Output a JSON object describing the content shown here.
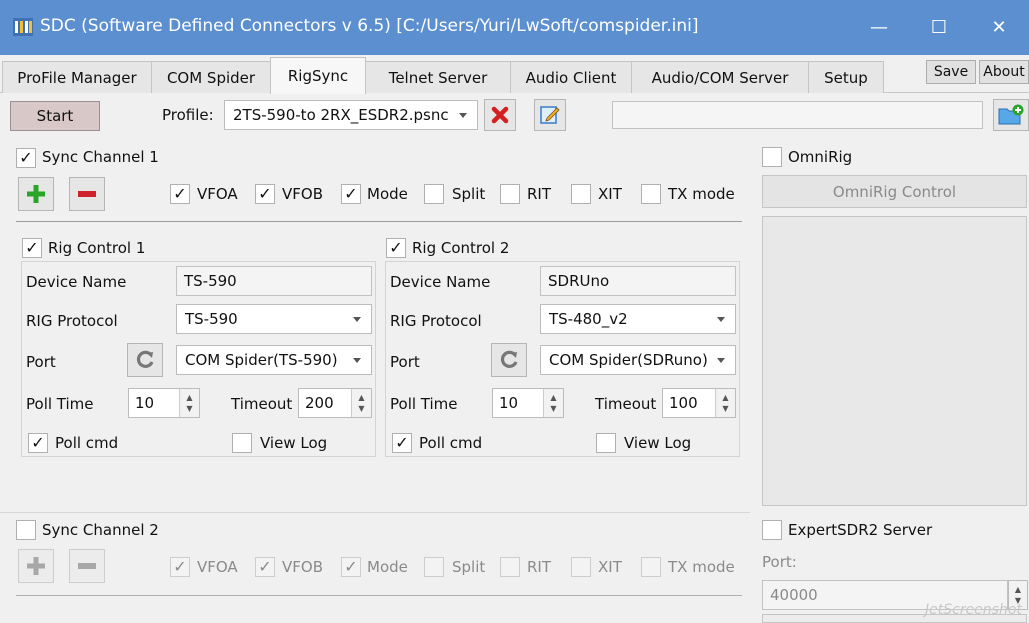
{
  "window": {
    "title": "SDC (Software Defined Connectors v 6.5) [C:/Users/Yuri/LwSoft/comspider.ini]",
    "minimize_glyph": "—",
    "maximize_glyph": "☐",
    "close_glyph": "✕"
  },
  "tabs": [
    {
      "label": "ProFile Manager",
      "active": false
    },
    {
      "label": "COM Spider",
      "active": false
    },
    {
      "label": "RigSync",
      "active": true
    },
    {
      "label": "Telnet Server",
      "active": false
    },
    {
      "label": "Audio Client",
      "active": false
    },
    {
      "label": "Audio/COM Server",
      "active": false
    },
    {
      "label": "Setup",
      "active": false
    }
  ],
  "top_buttons": {
    "save": "Save",
    "about": "About"
  },
  "toolbar": {
    "start_label": "Start",
    "profile_label": "Profile:",
    "profile_value": "2TS-590-to 2RX_ESDR2.psnc",
    "path_value": ""
  },
  "sync1": {
    "label": "Sync Channel 1",
    "checked": true,
    "options": [
      {
        "label": "VFOA",
        "checked": true
      },
      {
        "label": "VFOB",
        "checked": true
      },
      {
        "label": "Mode",
        "checked": true
      },
      {
        "label": "Split",
        "checked": false
      },
      {
        "label": "RIT",
        "checked": false
      },
      {
        "label": "XIT",
        "checked": false
      },
      {
        "label": "TX mode",
        "checked": false
      }
    ]
  },
  "rig1": {
    "title": "Rig Control 1",
    "device_name_label": "Device Name",
    "device_name": "TS-590",
    "protocol_label": "RIG Protocol",
    "protocol": "TS-590",
    "port_label": "Port",
    "port": "COM Spider(TS-590)",
    "poll_label": "Poll Time",
    "poll": "10",
    "timeout_label": "Timeout",
    "timeout": "200",
    "pollcmd_label": "Poll cmd",
    "viewlog_label": "View Log"
  },
  "rig2": {
    "title": "Rig Control 2",
    "device_name_label": "Device Name",
    "device_name": "SDRUno",
    "protocol_label": "RIG Protocol",
    "protocol": "TS-480_v2",
    "port_label": "Port",
    "port": "COM Spider(SDRuno)",
    "poll_label": "Poll Time",
    "poll": "10",
    "timeout_label": "Timeout",
    "timeout": "100",
    "pollcmd_label": "Poll cmd",
    "viewlog_label": "View Log"
  },
  "sync2": {
    "label": "Sync Channel 2",
    "checked": false,
    "options": [
      {
        "label": "VFOA",
        "checked": true
      },
      {
        "label": "VFOB",
        "checked": true
      },
      {
        "label": "Mode",
        "checked": true
      },
      {
        "label": "Split",
        "checked": false
      },
      {
        "label": "RIT",
        "checked": false
      },
      {
        "label": "XIT",
        "checked": false
      },
      {
        "label": "TX mode",
        "checked": false
      }
    ]
  },
  "omnirig": {
    "label": "OmniRig",
    "control_label": "OmniRig Control"
  },
  "expertsdr": {
    "label": "ExpertSDR2 Server",
    "port_label": "Port:",
    "port": "40000"
  },
  "watermark": "JetScreenshot",
  "check_glyph": "✓",
  "colors": {
    "titlebar": "#5b8fd0",
    "add_green": "#2aa52a",
    "remove_red": "#d0202a",
    "delete_red": "#d42020"
  }
}
